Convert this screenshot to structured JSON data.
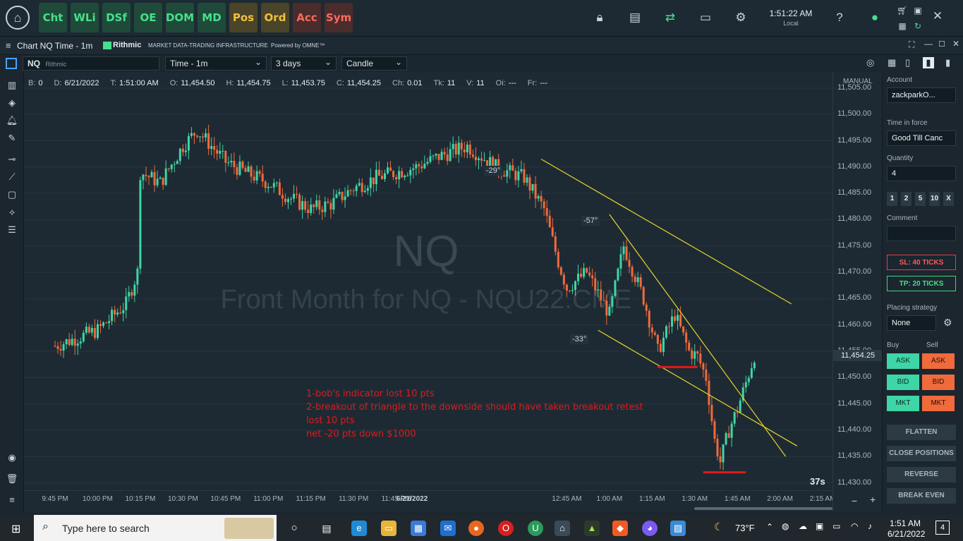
{
  "top_modules": [
    {
      "label": "Cht",
      "style": "green"
    },
    {
      "label": "WLi",
      "style": "green"
    },
    {
      "label": "DSf",
      "style": "green"
    },
    {
      "label": "OE",
      "style": "green"
    },
    {
      "label": "DOM",
      "style": "green"
    },
    {
      "label": "MD",
      "style": "green"
    },
    {
      "label": "Pos",
      "style": "olive"
    },
    {
      "label": "Ord",
      "style": "olive"
    },
    {
      "label": "Acc",
      "style": "red"
    },
    {
      "label": "Sym",
      "style": "red"
    }
  ],
  "clock": {
    "time": "1:51:22 AM",
    "zone": "Local"
  },
  "window": {
    "title": "Chart NQ Time - 1m",
    "brand": "Rithmic",
    "brand_tag": "Market Data-Trading Infrastructure",
    "powered": "Powered by OMNE™"
  },
  "toolbar": {
    "symbol": "NQ",
    "symbol_source": "Rithmic",
    "interval": "Time - 1m",
    "range": "3 days",
    "chart_style": "Candle"
  },
  "infobar": [
    {
      "k": "B:",
      "v": "0"
    },
    {
      "k": "D:",
      "v": "6/21/2022"
    },
    {
      "k": "T:",
      "v": "1:51:00 AM"
    },
    {
      "k": "O:",
      "v": "11,454.50"
    },
    {
      "k": "H:",
      "v": "11,454.75"
    },
    {
      "k": "L:",
      "v": "11,453.75"
    },
    {
      "k": "C:",
      "v": "11,454.25"
    },
    {
      "k": "Ch:",
      "v": "0.01"
    },
    {
      "k": "Tk:",
      "v": "11"
    },
    {
      "k": "V:",
      "v": "11"
    },
    {
      "k": "Oi:",
      "v": "---"
    },
    {
      "k": "Fr:",
      "v": "---"
    }
  ],
  "watermark": {
    "symbol": "NQ",
    "text": "Front Month for NQ - NQU22.CME"
  },
  "axis_mode": "MANUAL",
  "countdown": "37s",
  "annotations": {
    "angles": [
      "-29°",
      "-57°",
      "-33°"
    ],
    "note_lines": [
      "1-bob's indicator lost 10 pts",
      "2-breakout of triangle to the downside should have taken breakout retest",
      "lost 10 pts",
      "net -20 pts down $1000"
    ]
  },
  "colors": {
    "up": "#3ed6a6",
    "down": "#f06a3c",
    "trendline": "#e6d52a",
    "level_line": "#e0191b",
    "note_text": "#e0191b"
  },
  "chart_data": {
    "type": "candlestick",
    "symbol": "NQ",
    "interval": "1m",
    "y_ticks": [
      "11,505.00",
      "11,500.00",
      "11,495.00",
      "11,490.00",
      "11,485.00",
      "11,480.00",
      "11,475.00",
      "11,470.00",
      "11,465.00",
      "11,460.00",
      "11,455.00",
      "11,450.00",
      "11,445.00",
      "11,440.00",
      "11,435.00",
      "11,430.00"
    ],
    "ylim": [
      11429,
      11507
    ],
    "x_ticks": [
      "9:45 PM",
      "10:00 PM",
      "10:15 PM",
      "10:30 PM",
      "10:45 PM",
      "11:00 PM",
      "11:15 PM",
      "11:30 PM",
      "11:45 PM",
      "6/21/2022",
      "12:45 AM",
      "1:00 AM",
      "1:15 AM",
      "1:30 AM",
      "1:45 AM",
      "2:00 AM",
      "2:15 AM"
    ],
    "last_price": "11,454.25",
    "price_path": [
      [
        "9:45 PM",
        11456
      ],
      [
        "10:00 PM",
        11459
      ],
      [
        "10:10 PM",
        11464
      ],
      [
        "10:14 PM",
        11470
      ],
      [
        "10:15 PM",
        11489
      ],
      [
        "10:22 PM",
        11487
      ],
      [
        "10:30 PM",
        11494
      ],
      [
        "10:35 PM",
        11497
      ],
      [
        "10:45 PM",
        11491
      ],
      [
        "10:52 PM",
        11489
      ],
      [
        "11:00 PM",
        11487
      ],
      [
        "11:08 PM",
        11484
      ],
      [
        "11:15 PM",
        11482
      ],
      [
        "11:22 PM",
        11483
      ],
      [
        "11:30 PM",
        11486
      ],
      [
        "11:38 PM",
        11488
      ],
      [
        "11:45 PM",
        11489
      ],
      [
        "11:52 PM",
        11490
      ],
      [
        "12:00 AM",
        11492
      ],
      [
        "12:10 AM",
        11494
      ],
      [
        "12:20 AM",
        11490
      ],
      [
        "12:30 AM",
        11488
      ],
      [
        "12:37 AM",
        11482
      ],
      [
        "12:42 AM",
        11472
      ],
      [
        "12:45 AM",
        11467
      ],
      [
        "12:52 AM",
        11470
      ],
      [
        "1:00 AM",
        11462
      ],
      [
        "1:05 AM",
        11475
      ],
      [
        "1:12 AM",
        11465
      ],
      [
        "1:17 AM",
        11455
      ],
      [
        "1:23 AM",
        11462
      ],
      [
        "1:28 AM",
        11455
      ],
      [
        "1:31 AM",
        11454
      ],
      [
        "1:34 AM",
        11450
      ],
      [
        "1:37 AM",
        11438
      ],
      [
        "1:39 AM",
        11434
      ],
      [
        "1:42 AM",
        11440
      ],
      [
        "1:45 AM",
        11444
      ],
      [
        "1:48 AM",
        11449
      ],
      [
        "1:51 AM",
        11454.25
      ]
    ],
    "trendlines": [
      {
        "from": [
          "12:36 AM",
          11491.5
        ],
        "to": [
          "2:04 AM",
          11464
        ]
      },
      {
        "from": [
          "1:00 AM",
          11481
        ],
        "to": [
          "2:02 AM",
          11435
        ]
      },
      {
        "from": [
          "12:56 AM",
          11459
        ],
        "to": [
          "2:06 AM",
          11437
        ]
      }
    ],
    "horizontal_levels": [
      {
        "from": "1:17 AM",
        "to": "1:31 AM",
        "price": 11452
      },
      {
        "from": "1:33 AM",
        "to": "1:48 AM",
        "price": 11432
      }
    ]
  },
  "panel": {
    "account_label": "Account",
    "account_value": "zackparkO...",
    "tif_label": "Time in force",
    "tif_value": "Good Till Canc",
    "qty_label": "Quantity",
    "qty_value": "4",
    "qty_buttons": [
      "1",
      "2",
      "5",
      "10",
      "X"
    ],
    "comment_label": "Comment",
    "sl": "SL: 40 TICKS",
    "tp": "TP: 20 TICKS",
    "strategy_label": "Placing strategy",
    "strategy_value": "None",
    "buy_label": "Buy",
    "sell_label": "Sell",
    "ask": "ASK",
    "bid": "BID",
    "mkt": "MKT",
    "flatten": "FLATTEN",
    "close_positions": "CLOSE POSITIONS",
    "reverse": "REVERSE",
    "break_even": "BREAK EVEN"
  },
  "taskbar": {
    "search_placeholder": "Type here to search",
    "weather": "73°F",
    "time": "1:51 AM",
    "date": "6/21/2022",
    "notifications": "4"
  }
}
